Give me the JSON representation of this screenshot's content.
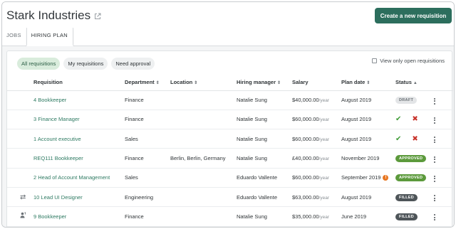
{
  "company": {
    "name": "Stark Industries"
  },
  "header": {
    "create_label": "Create a new requisition"
  },
  "tabs": [
    {
      "label": "JOBS",
      "active": false
    },
    {
      "label": "HIRING PLAN",
      "active": true
    }
  ],
  "filters": {
    "chips": [
      "All requisitions",
      "My requisitions",
      "Need approval"
    ],
    "active_chip": "All requisitions",
    "view_open_label": "View only open requisitions",
    "view_open_checked": false
  },
  "table": {
    "columns": [
      "Requisition",
      "Department",
      "Location",
      "Hiring manager",
      "Salary",
      "Plan date",
      "Status"
    ],
    "salary_unit": "/year",
    "rows": [
      {
        "icon": "",
        "requisition": "4 Bookkeeper",
        "department": "Finance",
        "location": "",
        "manager": "Natalie Sung",
        "salary": "$40,000.00",
        "plan_date": "August 2019",
        "status": "DRAFT",
        "warning": false
      },
      {
        "icon": "",
        "requisition": "3 Finance Manager",
        "department": "Finance",
        "location": "",
        "manager": "Natalie Sung",
        "salary": "$60,000.00",
        "plan_date": "August 2019",
        "status": "",
        "warning": false
      },
      {
        "icon": "",
        "requisition": "1 Account executive",
        "department": "Sales",
        "location": "",
        "manager": "Natalie Sung",
        "salary": "$60,000.00",
        "plan_date": "August 2019",
        "status": "",
        "warning": false
      },
      {
        "icon": "",
        "requisition": "REQ111 Bookkeeper",
        "department": "Finance",
        "location": "Berlin, Berlin, Germany",
        "manager": "Natalie Sung",
        "salary": "£40,000.00",
        "plan_date": "November 2019",
        "status": "APPROVED",
        "warning": false
      },
      {
        "icon": "",
        "requisition": "2 Head of Account Management",
        "department": "Sales",
        "location": "",
        "manager": "Eduardo Vallente",
        "salary": "$60,000.00",
        "plan_date": "September 2019",
        "status": "APPROVED",
        "warning": true
      },
      {
        "icon": "transfer-icon",
        "requisition": "10 Lead UI Designer",
        "department": "Engineering",
        "location": "",
        "manager": "Eduardo Vallente",
        "salary": "$63,000.00",
        "plan_date": "August 2019",
        "status": "FILLED",
        "warning": false
      },
      {
        "icon": "user-count-icon",
        "requisition": "9 Bookkeeper",
        "department": "Finance",
        "location": "",
        "manager": "Natalie Sung",
        "salary": "$35,000.00",
        "plan_date": "June 2019",
        "status": "FILLED",
        "warning": false
      }
    ]
  },
  "colors": {
    "brand": "#2c6e5d",
    "link": "#2e7a62",
    "approved": "#5c9a3c",
    "filled": "#4e5559",
    "draft": "#e3e5e7",
    "approve_check": "#3f9c37",
    "reject_cross": "#c8332b",
    "warning": "#e87722"
  }
}
